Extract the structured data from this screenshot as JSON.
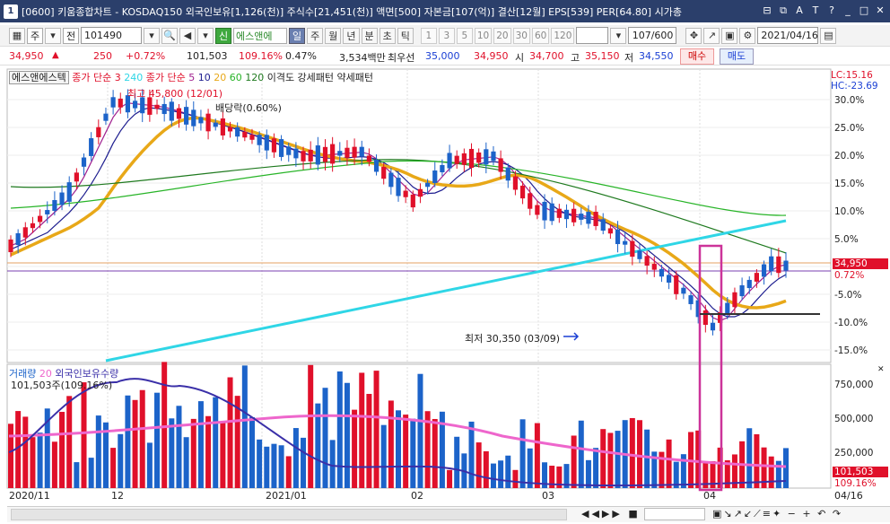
{
  "titlebar": {
    "win_number": "1",
    "text": "[0600] 키움종합차트 - KOSDAQ150 외국인보유[1,126(천)] 주식수[21,451(천)] 액면[500] 자본금[107(억)] 결산[12월] EPS[539] PER[64.80] 시가총",
    "icons": [
      "layout-icon",
      "copy-icon",
      "font-icon",
      "text-icon",
      "help-icon",
      "minimize-icon",
      "maximize-icon",
      "close-icon"
    ]
  },
  "toolbar": {
    "period_main": "주",
    "nav_prev": "전",
    "stock_code": "101490",
    "stock_name": "에스앤에",
    "credit_badge": "신",
    "tabs": [
      "일",
      "주",
      "월",
      "년",
      "분",
      "초",
      "틱"
    ],
    "active_tab": "일",
    "numbers": [
      "1",
      "3",
      "5",
      "10",
      "20",
      "30",
      "60",
      "120"
    ],
    "count_value": "107/600",
    "date_value": "2021/04/16"
  },
  "quote": {
    "price": "34,950",
    "change": "250",
    "change_pct": "+0.72%",
    "volume": "101,503",
    "volume_ratio": "109.16%",
    "turnover": "0.47%",
    "amount": "3,534백만",
    "priority_sell_label": "최우선",
    "priority_sell": "35,000",
    "priority_buy": "34,950",
    "open_label": "시",
    "open": "34,700",
    "high_label": "고",
    "high": "35,150",
    "low_label": "저",
    "low": "34,550",
    "buy_button": "매수",
    "sell_button": "매도"
  },
  "legend": {
    "stock_name": "에스앤에스텍",
    "ma_title_a": "종가 단순",
    "ma_a1": "3",
    "ma_a2": "240",
    "ma_title_b": "종가 단순",
    "ma_b1": "5",
    "ma_b2": "10",
    "ma_b3": "20",
    "ma_b4": "60",
    "ma_b5": "120",
    "extra": "이격도 강세패턴  약세패턴",
    "lc": "LC:15.16",
    "hc": "HC:-23.69"
  },
  "annotations": {
    "high": "최고 45,800 (12/01)",
    "dividend": "배당락(0.60%)",
    "low": "최저 30,350 (03/09)"
  },
  "right_axis": {
    "labels": [
      "30.0%",
      "25.0%",
      "20.0%",
      "15.0%",
      "10.0%",
      "5.0%",
      "0.0%",
      "-5.0%",
      "-10.0%",
      "-15.0%"
    ],
    "current_price": "34,950",
    "current_pct": "0.72%"
  },
  "volume_panel": {
    "title_a": "거래량",
    "title_a_period": "20",
    "title_b": "외국인보유수량",
    "info": "101,503주(109.16%)",
    "axis": [
      "750,000",
      "500,000",
      "250,000"
    ],
    "current_volume": "101,503",
    "current_pct": "109.16%"
  },
  "xaxis": {
    "labels": [
      "2020/11",
      "12",
      "2021/01",
      "02",
      "03",
      "04"
    ],
    "end_label": "04/16"
  },
  "colors": {
    "up": "#e0102a",
    "down": "#1c63c9",
    "ma3": "#1d1d8f",
    "ma5": "#a0208f",
    "ma20": "#e8a818",
    "ma60": "#28b428",
    "ma120": "#1f7a1f",
    "ma240": "#2fd6e6",
    "vol_ma": "#ee66cc",
    "foreign": "#3a2fa8",
    "highlight": "#cc3399"
  }
}
